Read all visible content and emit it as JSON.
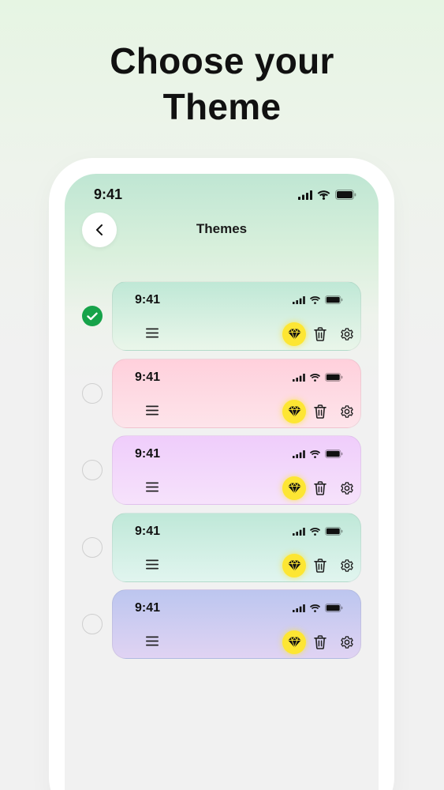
{
  "headline": {
    "line1": "Choose your",
    "line2": "Theme"
  },
  "status_bar": {
    "time": "9:41",
    "icons": [
      "signal-icon",
      "wifi-icon",
      "battery-icon"
    ]
  },
  "nav": {
    "title": "Themes",
    "back_icon": "chevron-left-icon"
  },
  "colors": {
    "selected": "#16a34a",
    "premium": "#fde633"
  },
  "themes": [
    {
      "time": "9:41",
      "selected": true,
      "gradient": [
        "#bfe8d6",
        "#eaf6ea"
      ]
    },
    {
      "time": "9:41",
      "selected": false,
      "gradient": [
        "#ffd0dc",
        "#fde4ea"
      ]
    },
    {
      "time": "9:41",
      "selected": false,
      "gradient": [
        "#efcdfb",
        "#f6e2fb"
      ]
    },
    {
      "time": "9:41",
      "selected": false,
      "gradient": [
        "#bfe8d8",
        "#e1f5ef"
      ]
    },
    {
      "time": "9:41",
      "selected": false,
      "gradient": [
        "#bcc6ef",
        "#e0d3f3"
      ]
    }
  ],
  "card_icons": [
    "menu-icon",
    "gem-icon",
    "trash-icon",
    "gear-icon"
  ]
}
